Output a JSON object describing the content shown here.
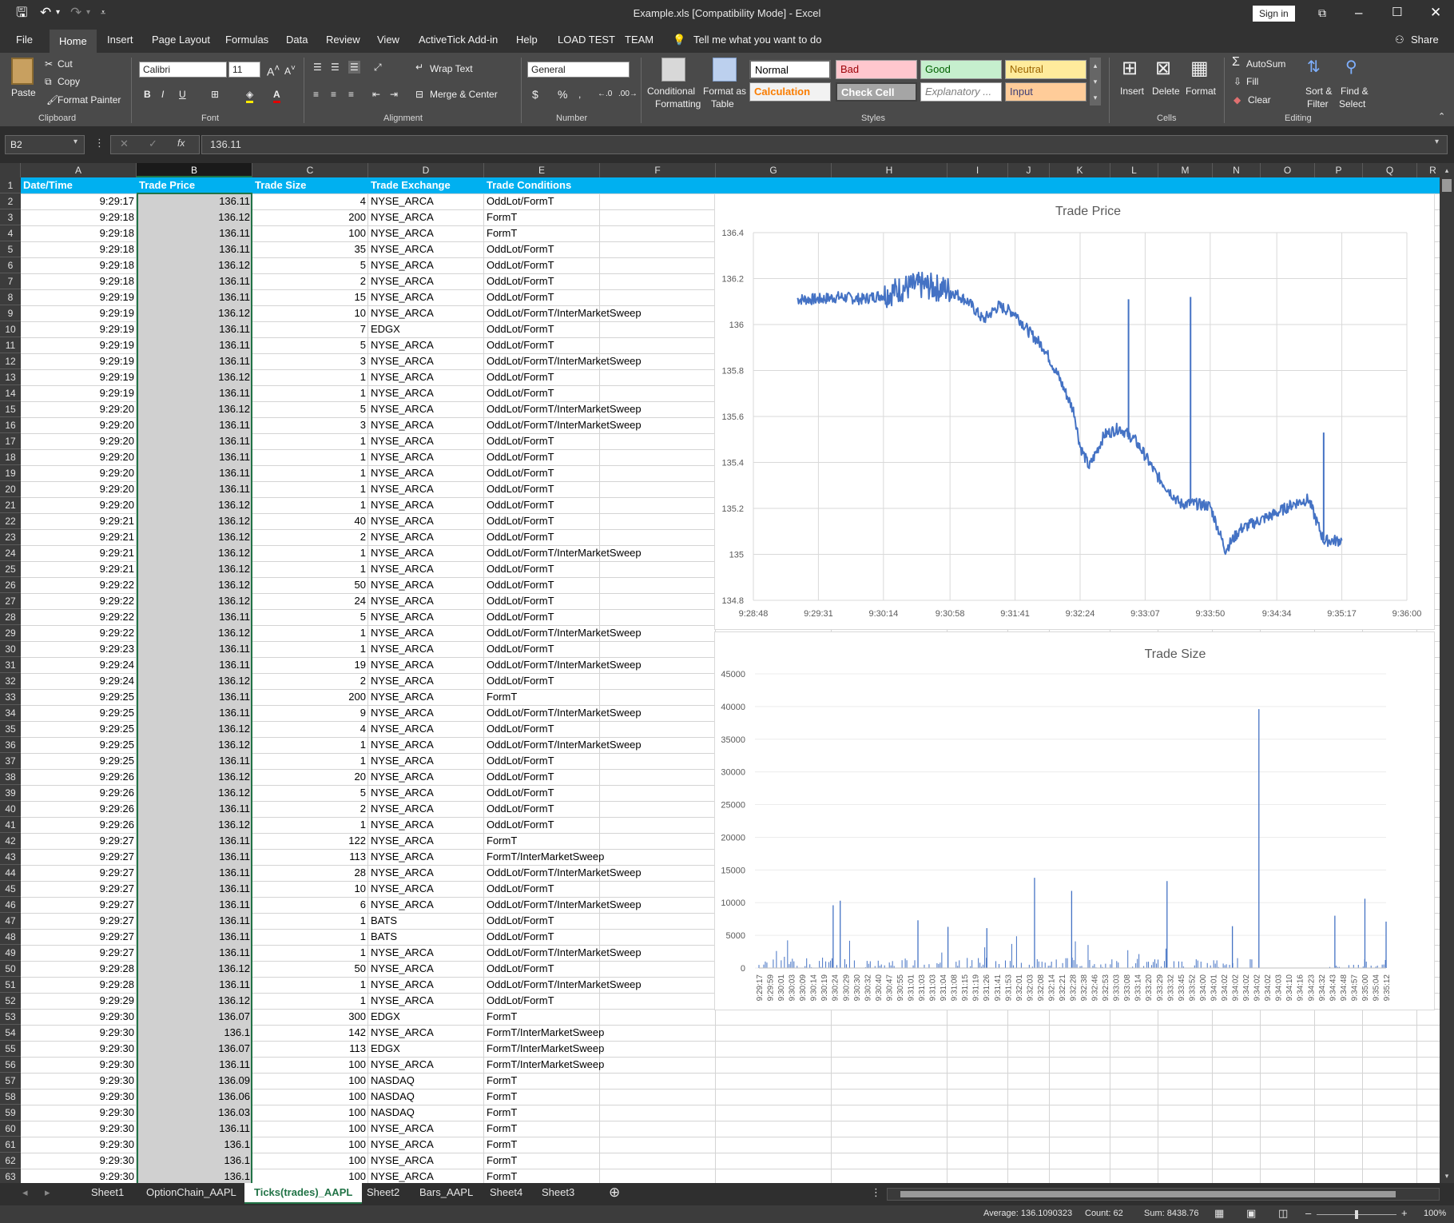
{
  "window": {
    "title": "Example.xls  [Compatibility Mode]  -  Excel",
    "sign_in": "Sign in",
    "share": "Share"
  },
  "menu_tabs": [
    "File",
    "Home",
    "Insert",
    "Page Layout",
    "Formulas",
    "Data",
    "Review",
    "View",
    "ActiveTick Add-in",
    "Help",
    "LOAD TEST",
    "TEAM"
  ],
  "tell_me": "Tell me what you want to do",
  "ribbon": {
    "clipboard": {
      "paste": "Paste",
      "cut": "Cut",
      "copy": "Copy",
      "format_painter": "Format Painter",
      "label": "Clipboard"
    },
    "font": {
      "name": "Calibri",
      "size": "11",
      "bold": "B",
      "italic": "I",
      "underline": "U",
      "label": "Font"
    },
    "alignment": {
      "wrap": "Wrap Text",
      "merge": "Merge & Center",
      "label": "Alignment"
    },
    "number": {
      "format": "General",
      "label": "Number"
    },
    "styles": {
      "cond1": "Conditional",
      "cond2": "Formatting",
      "fmt1": "Format as",
      "fmt2": "Table",
      "normal": "Normal",
      "bad": "Bad",
      "good": "Good",
      "neutral": "Neutral",
      "calculation": "Calculation",
      "check_cell": "Check Cell",
      "explanatory": "Explanatory ...",
      "input": "Input",
      "label": "Styles"
    },
    "cells": {
      "insert": "Insert",
      "delete": "Delete",
      "format": "Format",
      "label": "Cells"
    },
    "editing": {
      "autosum": "AutoSum",
      "fill": "Fill",
      "clear": "Clear",
      "sort1": "Sort &",
      "sort2": "Filter",
      "find1": "Find &",
      "find2": "Select",
      "label": "Editing"
    }
  },
  "formula_bar": {
    "name_box": "B2",
    "fx": "fx",
    "value": "136.11"
  },
  "column_letters": [
    "A",
    "B",
    "C",
    "D",
    "E",
    "F",
    "G",
    "H",
    "I",
    "J",
    "K",
    "L",
    "M",
    "N",
    "O",
    "P",
    "Q",
    "R"
  ],
  "headers": [
    "Date/Time",
    "Trade Price",
    "Trade Size",
    "Trade Exchange",
    "Trade Conditions"
  ],
  "rows": [
    [
      "9:29:17",
      "136.11",
      "4",
      "NYSE_ARCA",
      "OddLot/FormT"
    ],
    [
      "9:29:18",
      "136.12",
      "200",
      "NYSE_ARCA",
      "FormT"
    ],
    [
      "9:29:18",
      "136.11",
      "100",
      "NYSE_ARCA",
      "FormT"
    ],
    [
      "9:29:18",
      "136.11",
      "35",
      "NYSE_ARCA",
      "OddLot/FormT"
    ],
    [
      "9:29:18",
      "136.12",
      "5",
      "NYSE_ARCA",
      "OddLot/FormT"
    ],
    [
      "9:29:18",
      "136.11",
      "2",
      "NYSE_ARCA",
      "OddLot/FormT"
    ],
    [
      "9:29:19",
      "136.11",
      "15",
      "NYSE_ARCA",
      "OddLot/FormT"
    ],
    [
      "9:29:19",
      "136.12",
      "10",
      "NYSE_ARCA",
      "OddLot/FormT/InterMarketSweep"
    ],
    [
      "9:29:19",
      "136.11",
      "7",
      "EDGX",
      "OddLot/FormT"
    ],
    [
      "9:29:19",
      "136.11",
      "5",
      "NYSE_ARCA",
      "OddLot/FormT"
    ],
    [
      "9:29:19",
      "136.11",
      "3",
      "NYSE_ARCA",
      "OddLot/FormT/InterMarketSweep"
    ],
    [
      "9:29:19",
      "136.12",
      "1",
      "NYSE_ARCA",
      "OddLot/FormT"
    ],
    [
      "9:29:19",
      "136.11",
      "1",
      "NYSE_ARCA",
      "OddLot/FormT"
    ],
    [
      "9:29:20",
      "136.12",
      "5",
      "NYSE_ARCA",
      "OddLot/FormT/InterMarketSweep"
    ],
    [
      "9:29:20",
      "136.11",
      "3",
      "NYSE_ARCA",
      "OddLot/FormT/InterMarketSweep"
    ],
    [
      "9:29:20",
      "136.11",
      "1",
      "NYSE_ARCA",
      "OddLot/FormT"
    ],
    [
      "9:29:20",
      "136.11",
      "1",
      "NYSE_ARCA",
      "OddLot/FormT"
    ],
    [
      "9:29:20",
      "136.11",
      "1",
      "NYSE_ARCA",
      "OddLot/FormT"
    ],
    [
      "9:29:20",
      "136.11",
      "1",
      "NYSE_ARCA",
      "OddLot/FormT"
    ],
    [
      "9:29:20",
      "136.12",
      "1",
      "NYSE_ARCA",
      "OddLot/FormT"
    ],
    [
      "9:29:21",
      "136.12",
      "40",
      "NYSE_ARCA",
      "OddLot/FormT"
    ],
    [
      "9:29:21",
      "136.12",
      "2",
      "NYSE_ARCA",
      "OddLot/FormT"
    ],
    [
      "9:29:21",
      "136.12",
      "1",
      "NYSE_ARCA",
      "OddLot/FormT/InterMarketSweep"
    ],
    [
      "9:29:21",
      "136.12",
      "1",
      "NYSE_ARCA",
      "OddLot/FormT"
    ],
    [
      "9:29:22",
      "136.12",
      "50",
      "NYSE_ARCA",
      "OddLot/FormT"
    ],
    [
      "9:29:22",
      "136.12",
      "24",
      "NYSE_ARCA",
      "OddLot/FormT"
    ],
    [
      "9:29:22",
      "136.11",
      "5",
      "NYSE_ARCA",
      "OddLot/FormT"
    ],
    [
      "9:29:22",
      "136.12",
      "1",
      "NYSE_ARCA",
      "OddLot/FormT/InterMarketSweep"
    ],
    [
      "9:29:23",
      "136.11",
      "1",
      "NYSE_ARCA",
      "OddLot/FormT"
    ],
    [
      "9:29:24",
      "136.11",
      "19",
      "NYSE_ARCA",
      "OddLot/FormT/InterMarketSweep"
    ],
    [
      "9:29:24",
      "136.12",
      "2",
      "NYSE_ARCA",
      "OddLot/FormT"
    ],
    [
      "9:29:25",
      "136.11",
      "200",
      "NYSE_ARCA",
      "FormT"
    ],
    [
      "9:29:25",
      "136.11",
      "9",
      "NYSE_ARCA",
      "OddLot/FormT/InterMarketSweep"
    ],
    [
      "9:29:25",
      "136.12",
      "4",
      "NYSE_ARCA",
      "OddLot/FormT"
    ],
    [
      "9:29:25",
      "136.12",
      "1",
      "NYSE_ARCA",
      "OddLot/FormT/InterMarketSweep"
    ],
    [
      "9:29:25",
      "136.11",
      "1",
      "NYSE_ARCA",
      "OddLot/FormT"
    ],
    [
      "9:29:26",
      "136.12",
      "20",
      "NYSE_ARCA",
      "OddLot/FormT"
    ],
    [
      "9:29:26",
      "136.12",
      "5",
      "NYSE_ARCA",
      "OddLot/FormT"
    ],
    [
      "9:29:26",
      "136.11",
      "2",
      "NYSE_ARCA",
      "OddLot/FormT"
    ],
    [
      "9:29:26",
      "136.12",
      "1",
      "NYSE_ARCA",
      "OddLot/FormT"
    ],
    [
      "9:29:27",
      "136.11",
      "122",
      "NYSE_ARCA",
      "FormT"
    ],
    [
      "9:29:27",
      "136.11",
      "113",
      "NYSE_ARCA",
      "FormT/InterMarketSweep"
    ],
    [
      "9:29:27",
      "136.11",
      "28",
      "NYSE_ARCA",
      "OddLot/FormT/InterMarketSweep"
    ],
    [
      "9:29:27",
      "136.11",
      "10",
      "NYSE_ARCA",
      "OddLot/FormT"
    ],
    [
      "9:29:27",
      "136.11",
      "6",
      "NYSE_ARCA",
      "OddLot/FormT/InterMarketSweep"
    ],
    [
      "9:29:27",
      "136.11",
      "1",
      "BATS",
      "OddLot/FormT"
    ],
    [
      "9:29:27",
      "136.11",
      "1",
      "BATS",
      "OddLot/FormT"
    ],
    [
      "9:29:27",
      "136.11",
      "1",
      "NYSE_ARCA",
      "OddLot/FormT/InterMarketSweep"
    ],
    [
      "9:29:28",
      "136.12",
      "50",
      "NYSE_ARCA",
      "OddLot/FormT"
    ],
    [
      "9:29:28",
      "136.11",
      "1",
      "NYSE_ARCA",
      "OddLot/FormT/InterMarketSweep"
    ],
    [
      "9:29:29",
      "136.12",
      "1",
      "NYSE_ARCA",
      "OddLot/FormT"
    ],
    [
      "9:29:30",
      "136.07",
      "300",
      "EDGX",
      "FormT"
    ],
    [
      "9:29:30",
      "136.1",
      "142",
      "NYSE_ARCA",
      "FormT/InterMarketSweep"
    ],
    [
      "9:29:30",
      "136.07",
      "113",
      "EDGX",
      "FormT/InterMarketSweep"
    ],
    [
      "9:29:30",
      "136.11",
      "100",
      "NYSE_ARCA",
      "FormT/InterMarketSweep"
    ],
    [
      "9:29:30",
      "136.09",
      "100",
      "NASDAQ",
      "FormT"
    ],
    [
      "9:29:30",
      "136.06",
      "100",
      "NASDAQ",
      "FormT"
    ],
    [
      "9:29:30",
      "136.03",
      "100",
      "NASDAQ",
      "FormT"
    ],
    [
      "9:29:30",
      "136.11",
      "100",
      "NYSE_ARCA",
      "FormT"
    ],
    [
      "9:29:30",
      "136.1",
      "100",
      "NYSE_ARCA",
      "FormT"
    ],
    [
      "9:29:30",
      "136.1",
      "100",
      "NYSE_ARCA",
      "FormT"
    ],
    [
      "9:29:30",
      "136.1",
      "100",
      "NYSE_ARCA",
      "FormT"
    ]
  ],
  "chart_data": [
    {
      "type": "line",
      "title": "Trade Price",
      "x_tick_labels": [
        "9:28:48",
        "9:29:31",
        "9:30:14",
        "9:30:58",
        "9:31:41",
        "9:32:24",
        "9:33:07",
        "9:33:50",
        "9:34:34",
        "9:35:17",
        "9:36:00"
      ],
      "y_tick_labels": [
        "134.8",
        "135",
        "135.2",
        "135.4",
        "135.6",
        "135.8",
        "136",
        "136.2",
        "136.4"
      ],
      "ylim": [
        134.8,
        136.4
      ],
      "grid": true,
      "legend": "none",
      "color": "#4472c4",
      "series": [
        {
          "x": [
            "9:29:17",
            "9:29:31",
            "9:29:45",
            "9:30:00",
            "9:30:14",
            "9:30:28",
            "9:30:40",
            "9:30:58",
            "9:31:10",
            "9:31:20",
            "9:31:30",
            "9:31:41",
            "9:31:50",
            "9:32:00",
            "9:32:10",
            "9:32:20",
            "9:32:24",
            "9:32:30",
            "9:32:40",
            "9:32:50",
            "9:33:00",
            "9:33:07",
            "9:33:14",
            "9:33:20",
            "9:33:30",
            "9:33:40",
            "9:33:50",
            "9:34:00",
            "9:34:10",
            "9:34:20",
            "9:34:34",
            "9:34:45",
            "9:34:55",
            "9:35:05",
            "9:35:17"
          ],
          "y": [
            136.11,
            136.11,
            136.12,
            136.11,
            136.13,
            136.16,
            136.17,
            136.15,
            136.1,
            136.02,
            136.08,
            136.05,
            135.97,
            135.9,
            135.77,
            135.62,
            135.47,
            135.38,
            135.52,
            135.55,
            135.5,
            135.43,
            135.35,
            135.3,
            135.22,
            135.22,
            135.21,
            135.02,
            135.11,
            135.14,
            135.18,
            135.22,
            135.24,
            135.06,
            135.06
          ]
        }
      ]
    },
    {
      "type": "bar",
      "title": "Trade Size",
      "y_tick_labels": [
        "0",
        "5000",
        "10000",
        "15000",
        "20000",
        "25000",
        "30000",
        "35000",
        "40000",
        "45000"
      ],
      "ylim": [
        0,
        45000
      ],
      "grid": true,
      "legend": "none",
      "color": "#4472c4",
      "x_tick_labels": [
        "9:29:17",
        "9:29:59",
        "9:30:01",
        "9:30:03",
        "9:30:09",
        "9:30:14",
        "9:30:19",
        "9:30:24",
        "9:30:29",
        "9:30:30",
        "9:30:32",
        "9:30:40",
        "9:30:47",
        "9:30:55",
        "9:31:01",
        "9:31:03",
        "9:31:03",
        "9:31:04",
        "9:31:08",
        "9:31:15",
        "9:31:19",
        "9:31:26",
        "9:31:41",
        "9:31:53",
        "9:32:01",
        "9:32:03",
        "9:32:08",
        "9:32:14",
        "9:32:21",
        "9:32:28",
        "9:32:38",
        "9:32:46",
        "9:32:53",
        "9:33:03",
        "9:33:08",
        "9:33:14",
        "9:33:20",
        "9:33:29",
        "9:33:32",
        "9:33:45",
        "9:33:52",
        "9:34:00",
        "9:34:01",
        "9:34:02",
        "9:34:02",
        "9:34:02",
        "9:34:02",
        "9:34:02",
        "9:34:03",
        "9:34:10",
        "9:34:16",
        "9:34:23",
        "9:34:32",
        "9:34:43",
        "9:34:48",
        "9:34:57",
        "9:35:00",
        "9:35:04",
        "9:35:12"
      ],
      "spikes": [
        {
          "x": "9:29:59",
          "value": 9600
        },
        {
          "x": "9:30:03",
          "value": 10300
        },
        {
          "x": "9:30:47",
          "value": 7300
        },
        {
          "x": "9:31:04",
          "value": 6300
        },
        {
          "x": "9:31:26",
          "value": 6100
        },
        {
          "x": "9:31:53",
          "value": 13800
        },
        {
          "x": "9:32:14",
          "value": 11800
        },
        {
          "x": "9:33:08",
          "value": 13300
        },
        {
          "x": "9:33:45",
          "value": 6400
        },
        {
          "x": "9:34:00",
          "value": 39600
        },
        {
          "x": "9:34:43",
          "value": 8000
        },
        {
          "x": "9:35:00",
          "value": 10600
        },
        {
          "x": "9:35:12",
          "value": 7100
        }
      ]
    }
  ],
  "sheet_tabs": [
    "Sheet1",
    "OptionChain_AAPL",
    "Ticks(trades)_AAPL",
    "Sheet2",
    "Bars_AAPL",
    "Sheet4",
    "Sheet3"
  ],
  "active_sheet": "Ticks(trades)_AAPL",
  "status": {
    "average": "Average: 136.1090323",
    "count": "Count: 62",
    "sum": "Sum: 8438.76",
    "zoom": "100%"
  }
}
